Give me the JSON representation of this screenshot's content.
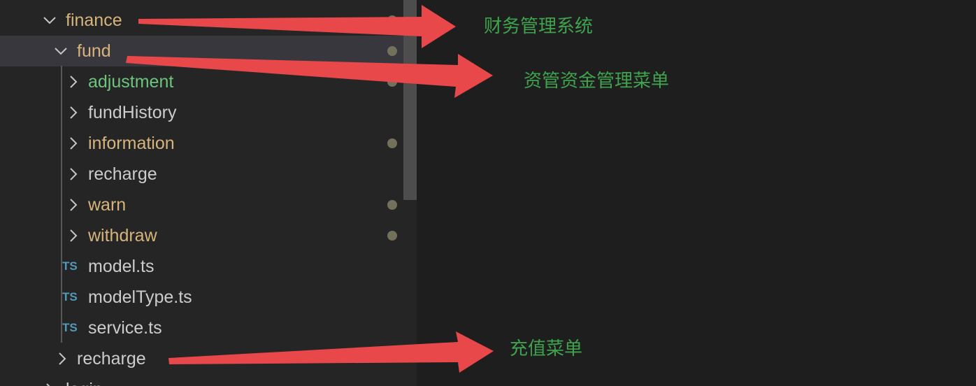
{
  "explorer": {
    "tree": [
      {
        "label": "finance",
        "color": "#d6b47b",
        "kind": "folder-open",
        "dot": true
      },
      {
        "label": "fund",
        "color": "#d6b47b",
        "kind": "folder-open",
        "dot": true,
        "selected": true
      },
      {
        "label": "adjustment",
        "color": "#6cc57c",
        "kind": "folder-closed",
        "dot": true
      },
      {
        "label": "fundHistory",
        "color": "#cccccc",
        "kind": "folder-closed",
        "dot": false
      },
      {
        "label": "information",
        "color": "#d6b47b",
        "kind": "folder-closed",
        "dot": true
      },
      {
        "label": "recharge",
        "color": "#cccccc",
        "kind": "folder-closed",
        "dot": false
      },
      {
        "label": "warn",
        "color": "#d6b47b",
        "kind": "folder-closed",
        "dot": true
      },
      {
        "label": "withdraw",
        "color": "#d6b47b",
        "kind": "folder-closed",
        "dot": true
      },
      {
        "label": "model.ts",
        "color": "#cccccc",
        "kind": "file-ts",
        "icon_text": "TS"
      },
      {
        "label": "modelType.ts",
        "color": "#cccccc",
        "kind": "file-ts",
        "icon_text": "TS"
      },
      {
        "label": "service.ts",
        "color": "#cccccc",
        "kind": "file-ts",
        "icon_text": "TS"
      },
      {
        "label": "recharge",
        "color": "#cccccc",
        "kind": "folder-closed",
        "dot": false
      },
      {
        "label": "login",
        "color": "#cccccc",
        "kind": "folder-closed",
        "dot": false
      }
    ]
  },
  "annotations": {
    "finance_note": "财务管理系统",
    "fund_note": "资管资金管理菜单",
    "recharge_note": "充值菜单"
  },
  "colors": {
    "arrow": "#e8484a",
    "annotation_text": "#3fa34d",
    "git_dot": "#73705c"
  }
}
